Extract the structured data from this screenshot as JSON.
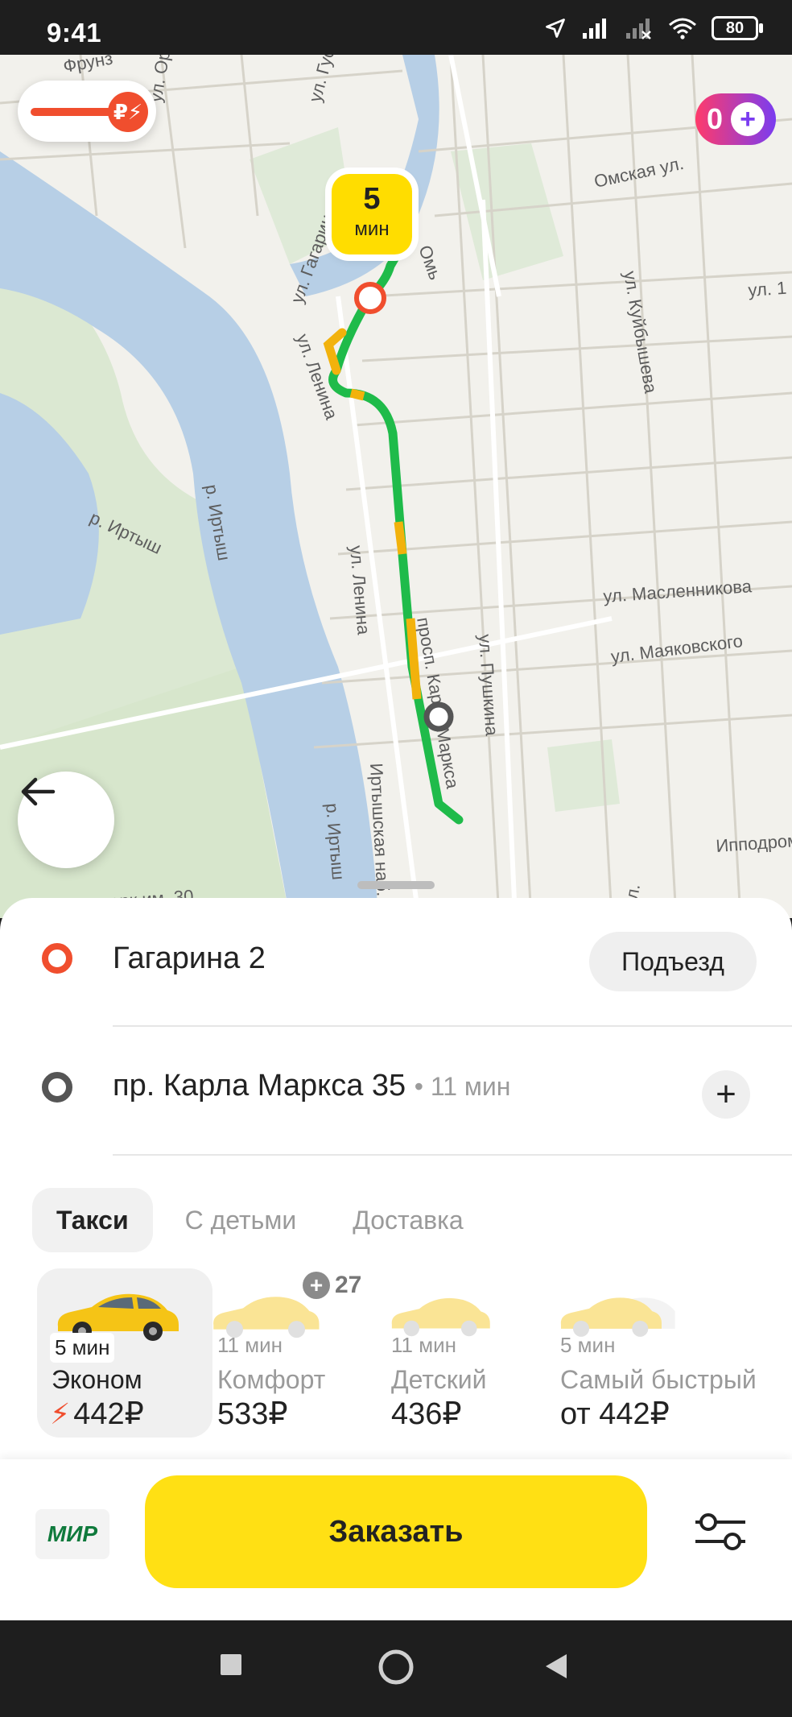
{
  "status_bar": {
    "time": "9:41",
    "battery": "80"
  },
  "map": {
    "eta": {
      "value": "5",
      "unit": "мин"
    },
    "toggle_icon": "₽⚡",
    "plus_count": "0",
    "street_labels": [
      "Омская ул.",
      "ул. Куйбышева",
      "ул. Гагарина",
      "ул. Ленина",
      "ул. Ленина",
      "р. Иртыш",
      "р. Иртыш",
      "ул. Пушкина",
      "ул. Масленникова",
      "ул. Маяковского",
      "просп. Карла Маркса",
      "Иртышская наб.",
      "Ипподром",
      "Омь",
      "ул. 1",
      "парк им. 30",
      "р. Иртыш",
      "ул. Гус",
      "ул. Ор",
      "Фрунз",
      "ул."
    ]
  },
  "route": {
    "from": {
      "address": "Гагарина 2",
      "entrance_label": "Подъезд"
    },
    "to": {
      "address": "пр. Карла Маркса 35",
      "duration": "• 11 мин"
    }
  },
  "tabs": [
    "Такси",
    "С детьми",
    "Доставка"
  ],
  "tariffs": [
    {
      "time": "5 мин",
      "name": "Эконом",
      "price": "442₽",
      "surge": true
    },
    {
      "time": "11 мин",
      "name": "Комфорт",
      "price": "533₽",
      "promo": "27"
    },
    {
      "time": "11 мин",
      "name": "Детский",
      "price": "436₽"
    },
    {
      "time": "5 мин",
      "name": "Самый быстрый",
      "price": "от 442₽"
    }
  ],
  "bottom": {
    "payment_label": "МИР",
    "order_label": "Заказать"
  },
  "colors": {
    "accent": "#ffe014",
    "origin": "#f04e2e",
    "route_green": "#1fbb4a",
    "route_yellow": "#f2b20c"
  }
}
